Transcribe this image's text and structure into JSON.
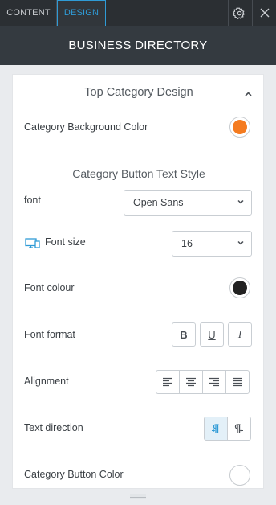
{
  "tabs": [
    {
      "label": "CONTENT",
      "active": false
    },
    {
      "label": "DESIGN",
      "active": true
    }
  ],
  "header": {
    "title": "BUSINESS DIRECTORY"
  },
  "section": {
    "title": "Top Category Design"
  },
  "category_bg": {
    "label": "Category Background Color",
    "color": "#f47b20"
  },
  "subsection": {
    "title": "Category Button Text Style"
  },
  "font": {
    "label": "font",
    "value": "Open Sans"
  },
  "font_size": {
    "label": "Font size",
    "value": "16"
  },
  "font_colour": {
    "label": "Font colour",
    "color": "#222222"
  },
  "font_format": {
    "label": "Font format",
    "buttons": [
      "B",
      "U",
      "I"
    ]
  },
  "alignment": {
    "label": "Alignment"
  },
  "text_direction": {
    "label": "Text direction"
  },
  "category_button": {
    "label": "Category Button Color",
    "color": "#ffffff"
  },
  "colors": {
    "accent": "#2f9bd6",
    "topbar": "#2b2f33",
    "header": "#343a40"
  }
}
